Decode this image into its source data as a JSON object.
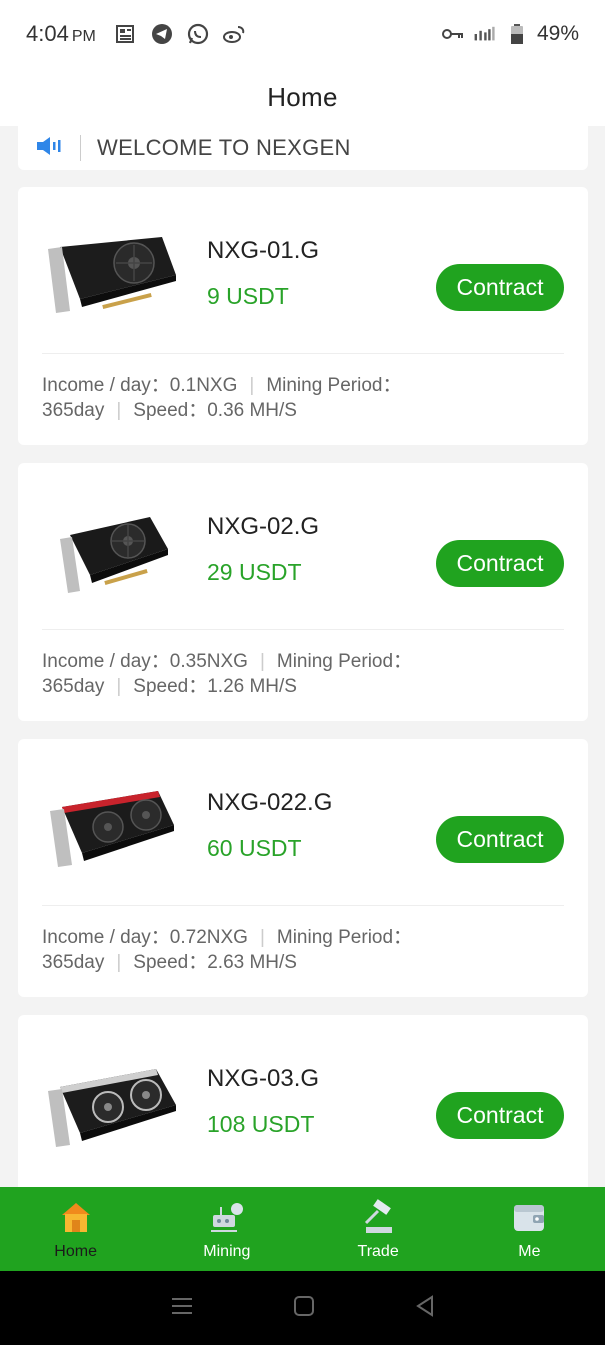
{
  "status_bar": {
    "time": "4:04",
    "ampm": "PM",
    "battery": "49%"
  },
  "header": {
    "title": "Home"
  },
  "notice": {
    "text": "WELCOME TO NEXGEN"
  },
  "products": [
    {
      "name": "NXG-01.G",
      "price": "9 USDT",
      "button": "Contract",
      "income_label": "Income / day：0.1NXG",
      "period_label": "Mining Period：",
      "period_value": "365day",
      "speed_label": "Speed：0.36 MH/S"
    },
    {
      "name": "NXG-02.G",
      "price": "29 USDT",
      "button": "Contract",
      "income_label": "Income / day：0.35NXG",
      "period_label": "Mining Period：",
      "period_value": "365day",
      "speed_label": "Speed：1.26 MH/S"
    },
    {
      "name": "NXG-022.G",
      "price": "60 USDT",
      "button": "Contract",
      "income_label": "Income / day：0.72NXG",
      "period_label": "Mining Period：",
      "period_value": "365day",
      "speed_label": "Speed：2.63 MH/S"
    },
    {
      "name": "NXG-03.G",
      "price": "108 USDT",
      "button": "Contract"
    }
  ],
  "nav": {
    "items": [
      {
        "label": "Home",
        "icon": "home-icon",
        "active": true
      },
      {
        "label": "Mining",
        "icon": "mining-icon"
      },
      {
        "label": "Trade",
        "icon": "trade-icon"
      },
      {
        "label": "Me",
        "icon": "wallet-icon"
      }
    ]
  },
  "colors": {
    "accent": "#20a31f",
    "price": "#29a329",
    "background": "#f3f3f3"
  }
}
